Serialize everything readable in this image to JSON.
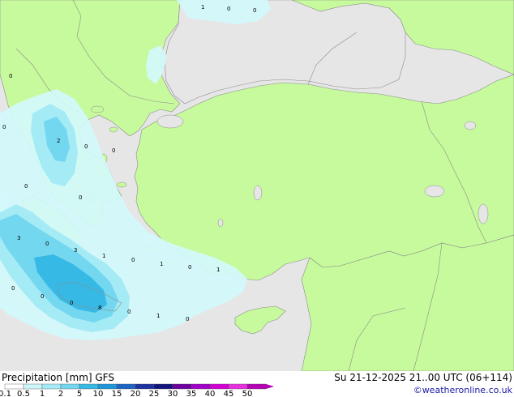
{
  "header": {
    "title_left": "Precipitation [mm]  GFS",
    "title_right": "Su 21-12-2025 21..00 UTC (06+114)",
    "credit": "©weatheronline.co.uk"
  },
  "legend": {
    "labels": [
      "0.1",
      "0.5",
      "1",
      "2",
      "5",
      "10",
      "15",
      "20",
      "25",
      "30",
      "35",
      "40",
      "45",
      "50"
    ],
    "colors": [
      "#ffffff",
      "#cdf5fa",
      "#a5ebf5",
      "#73d7f0",
      "#37b9e6",
      "#1e96d7",
      "#1e64c3",
      "#1e32a0",
      "#14147d",
      "#6e00a0",
      "#a000c8",
      "#d200d2",
      "#e632dc",
      "#b400b4"
    ]
  },
  "map_colors": {
    "sea": "#e6e6e6",
    "land": "#c6fa9c",
    "border": "#8c8c8c",
    "precip_light": "#d2f8fc",
    "precip_medium": "#a5ebf5",
    "precip_heavy": "#73d7f0",
    "precip_core": "#37b9e6"
  },
  "map_labels": [
    {
      "text": "1"
    },
    {
      "text": "0"
    },
    {
      "text": "0"
    },
    {
      "text": "0"
    },
    {
      "text": "0"
    },
    {
      "text": "2"
    },
    {
      "text": "0"
    },
    {
      "text": "0"
    },
    {
      "text": "0"
    },
    {
      "text": "0"
    },
    {
      "text": "3"
    },
    {
      "text": "0"
    },
    {
      "text": "3"
    },
    {
      "text": "1"
    },
    {
      "text": "0"
    },
    {
      "text": "1"
    },
    {
      "text": "0"
    },
    {
      "text": "1"
    },
    {
      "text": "0"
    },
    {
      "text": "0"
    },
    {
      "text": "0"
    },
    {
      "text": "8"
    },
    {
      "text": "0"
    },
    {
      "text": "1"
    },
    {
      "text": "0"
    }
  ]
}
